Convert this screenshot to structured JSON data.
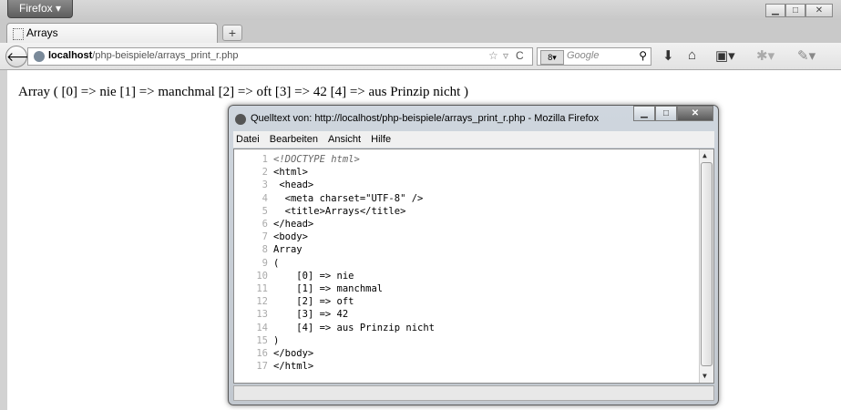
{
  "browser": {
    "menu_button_label": "Firefox ▾",
    "tab_title": "Arrays",
    "new_tab_label": "+",
    "url_host": "localhost",
    "url_path": "/php-beispiele/arrays_print_r.php",
    "search_placeholder": "Google",
    "search_engine_label": "8▾"
  },
  "page": {
    "output_text": "Array ( [0] => nie [1] => manchmal [2] => oft [3] => 42 [4] => aus Prinzip nicht )"
  },
  "source_window": {
    "title": "Quelltext von: http://localhost/php-beispiele/arrays_print_r.php - Mozilla Firefox",
    "menu": [
      "Datei",
      "Bearbeiten",
      "Ansicht",
      "Hilfe"
    ],
    "lines": [
      {
        "num": "1",
        "text": "<!DOCTYPE html>"
      },
      {
        "num": "2",
        "text": "<html>"
      },
      {
        "num": "3",
        "text": " <head>"
      },
      {
        "num": "4",
        "text": "  <meta charset=\"UTF-8\" />"
      },
      {
        "num": "5",
        "text": "  <title>Arrays</title>"
      },
      {
        "num": "6",
        "text": "</head>"
      },
      {
        "num": "7",
        "text": "<body>"
      },
      {
        "num": "8",
        "text": "Array"
      },
      {
        "num": "9",
        "text": "("
      },
      {
        "num": "10",
        "text": "    [0] => nie"
      },
      {
        "num": "11",
        "text": "    [1] => manchmal"
      },
      {
        "num": "12",
        "text": "    [2] => oft"
      },
      {
        "num": "13",
        "text": "    [3] => 42"
      },
      {
        "num": "14",
        "text": "    [4] => aus Prinzip nicht"
      },
      {
        "num": "15",
        "text": ")"
      },
      {
        "num": "16",
        "text": "</body>"
      },
      {
        "num": "17",
        "text": "</html>"
      }
    ]
  }
}
